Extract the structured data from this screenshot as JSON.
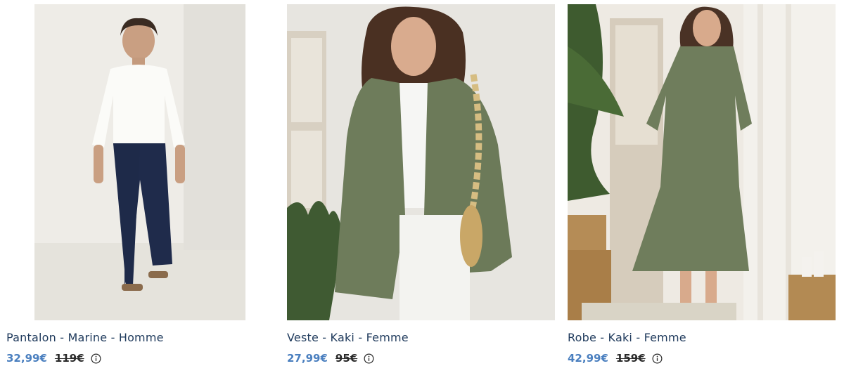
{
  "products": [
    {
      "title": "Pantalon - Marine - Homme",
      "price": "32,99€",
      "old_price": "119€",
      "info_icon": "info-circle-icon"
    },
    {
      "title": "Veste - Kaki - Femme",
      "price": "27,99€",
      "old_price": "95€",
      "info_icon": "info-circle-icon"
    },
    {
      "title": "Robe - Kaki - Femme",
      "price": "42,99€",
      "old_price": "159€",
      "info_icon": "info-circle-icon"
    }
  ],
  "colors": {
    "title": "#1f3a5c",
    "price": "#4a7fbf",
    "old_price": "#2a2a2a"
  }
}
